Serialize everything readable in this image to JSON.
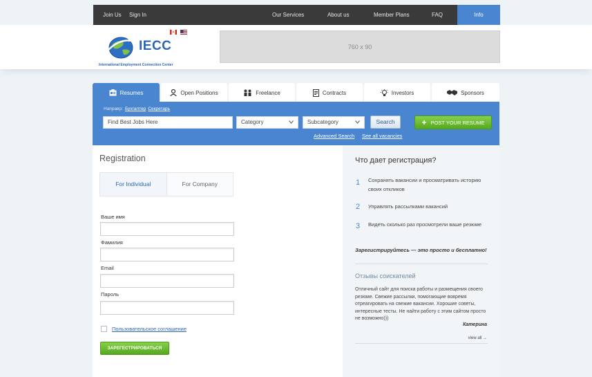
{
  "topnav": {
    "join": "Join Us",
    "signin": "Sign In",
    "services": "Our Services",
    "about": "About us",
    "plans": "Member Plans",
    "faq": "FAQ",
    "info": "Info"
  },
  "header": {
    "brand": "IECC",
    "tagline": "International Employment  Connection Center",
    "banner": "760 x 90"
  },
  "tabs": [
    "Resumes",
    "Open Positions",
    "Freelance",
    "Contracts",
    "Investors",
    "Sponsors"
  ],
  "search": {
    "direction_label": "Направр:",
    "direction_links": [
      "Бухгалтер",
      "Секретарь"
    ],
    "query_placeholder": "Find Best Jobs Here",
    "category": "Category",
    "subcategory": "Subcategory",
    "search_button": "Search",
    "post_resume": "POST YOUR RESUME",
    "advanced": "Advanced Search",
    "all_vacancies": "See all vacancies"
  },
  "registration": {
    "title": "Registration",
    "type_individual": "For Individual",
    "type_company": "For Company",
    "fields": [
      "Ваше имя",
      "Фамилия",
      "Email",
      "Пароль"
    ],
    "agreement": "Пользовательское соглашение",
    "submit": "ЗАРЕГЕСТРИРОВАТЬСЯ"
  },
  "sidebar": {
    "title": "Что дает регистрация?",
    "benefits": [
      {
        "num": "1",
        "text": "Сохранять вакансии и просматривать историю своих откликов"
      },
      {
        "num": "2",
        "text": "Управлять рассылками вакансий"
      },
      {
        "num": "3",
        "text": "Видеть сколько раз просмотрели ваше резюме"
      }
    ],
    "cta": "Зарегистрируйтесь — это просто и бесплатно!",
    "reviews_title": "Отзывы соискателей",
    "review_text": "Отличный сайт для поиска работы и размещения своего резюме. Свежие рассылки, помогающие вовремя отреагировать на свежие вакансии. Хорошие советы, интересные тесты. Не найти работу с этим сайтом просто не возможно)))",
    "review_author": "Катерина",
    "view_all": "view all →"
  },
  "colors": {
    "accent_blue": "#4a86cf",
    "green_button": "#55a81f",
    "topbar": "#3a3a3a"
  }
}
